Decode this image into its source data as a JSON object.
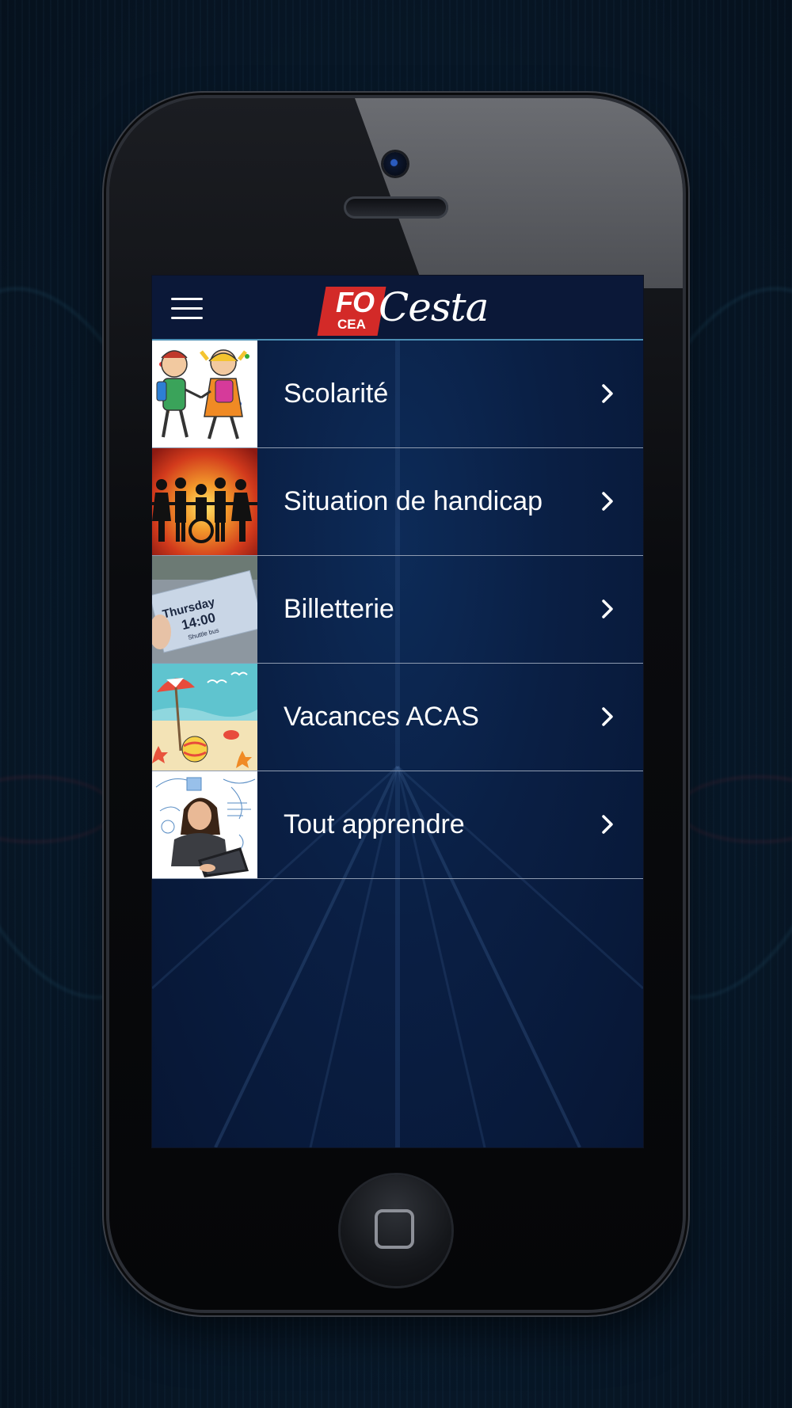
{
  "app": {
    "logo": {
      "badge_text": "FO",
      "badge_subtext": "CEA",
      "script_text": "Cesta"
    }
  },
  "header": {
    "menu_icon": "hamburger-menu-icon"
  },
  "menu": {
    "items": [
      {
        "label": "Scolarité",
        "thumbnail": "children-with-backpacks"
      },
      {
        "label": "Situation de handicap",
        "thumbnail": "people-silhouettes-sunset"
      },
      {
        "label": "Billetterie",
        "thumbnail": "ticket",
        "thumbnail_text": [
          "Thursday",
          "14:00",
          "Shuttle bus"
        ]
      },
      {
        "label": "Vacances ACAS",
        "thumbnail": "beach-scene"
      },
      {
        "label": "Tout apprendre",
        "thumbnail": "girl-with-laptop"
      }
    ],
    "chevron_icon": "chevron-right-icon"
  },
  "colors": {
    "header_bg": "#0b1838",
    "screen_bg": "#0a1f44",
    "accent_line": "#4c8fb4",
    "logo_red": "#d32a28",
    "text": "#ffffff"
  }
}
